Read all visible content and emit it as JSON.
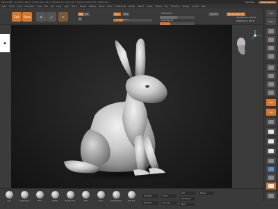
{
  "window": {
    "title_text": "ZBrush 4R8 • Tool Mem 4,080.4 • Scratch Disk 1,134 • ActivePoints • Timer 0.01 • PolyCount 230 234 M • MeshFrame …",
    "right_buttons": [
      "QuickSave",
      "Default ZScript"
    ]
  },
  "menubar": {
    "items": [
      "Alpha",
      "Brush",
      "Color",
      "Document",
      "Draw",
      "Edit",
      "File",
      "Layer",
      "Light",
      "Macro",
      "Marker",
      "Material",
      "Movie",
      "Picker",
      "Preferences",
      "Render",
      "Stencil",
      "Stroke",
      "Texture",
      "Tool",
      "Transform",
      "Zplugin",
      "Zscript",
      "Help"
    ]
  },
  "toolbar": {
    "edit_label": "Edit",
    "draw_label": "Draw",
    "rgb_label": "Rgb",
    "zadd_label": "Zadd",
    "zsub_label": "Zsub",
    "mrgb_label": "Mrgb",
    "m_label": "M",
    "focal_label": "Focal Shift 0",
    "draw_size_label": "Draw Size 64",
    "z_intensity_label": "Z Intensity 25",
    "rgb_intensity_label": "Rgb Intensity 100",
    "dynamic_label": "Dynamic",
    "active_points_label": "ActivePoints: 2.234 M",
    "total_points_label": "TotalPoints: 2.234 M",
    "z_intensity_level": 0.25,
    "draw_size_level": 0.3,
    "focal_level": 0.5
  },
  "viewport": {
    "model": "rabbit-sculpt"
  },
  "right_shelf": {
    "buttons": [
      "BPR",
      "SPix 3",
      "Scroll",
      "Zoom",
      "Actual",
      "AAHalf",
      "Dynamic",
      "Persp",
      "Floor",
      "Local",
      "LSym",
      "Gyz",
      "Frame",
      "Move",
      "Scale",
      "Rotate",
      "Line Fill",
      "PolyF",
      "Transp",
      "Solo",
      "Xpose"
    ]
  },
  "bottom_tray": {
    "brushes": [
      "Clay",
      "ClayBuildup",
      "Move",
      "hPolish",
      "TrimDynamic",
      "Inflat",
      "Pinch",
      "DamStandard",
      "Standard",
      "Orb_Cracks"
    ],
    "fields": [
      "DynaMesh",
      "Resolution",
      "Divide",
      "Del Lower",
      "Smt",
      "ZRemesher",
      "Mirror",
      "Project"
    ]
  },
  "colors": {
    "accent": "#d6782c",
    "panel": "#3a3a3a",
    "viewport_center": "#2f2f2f",
    "viewport_edge": "#121212"
  }
}
